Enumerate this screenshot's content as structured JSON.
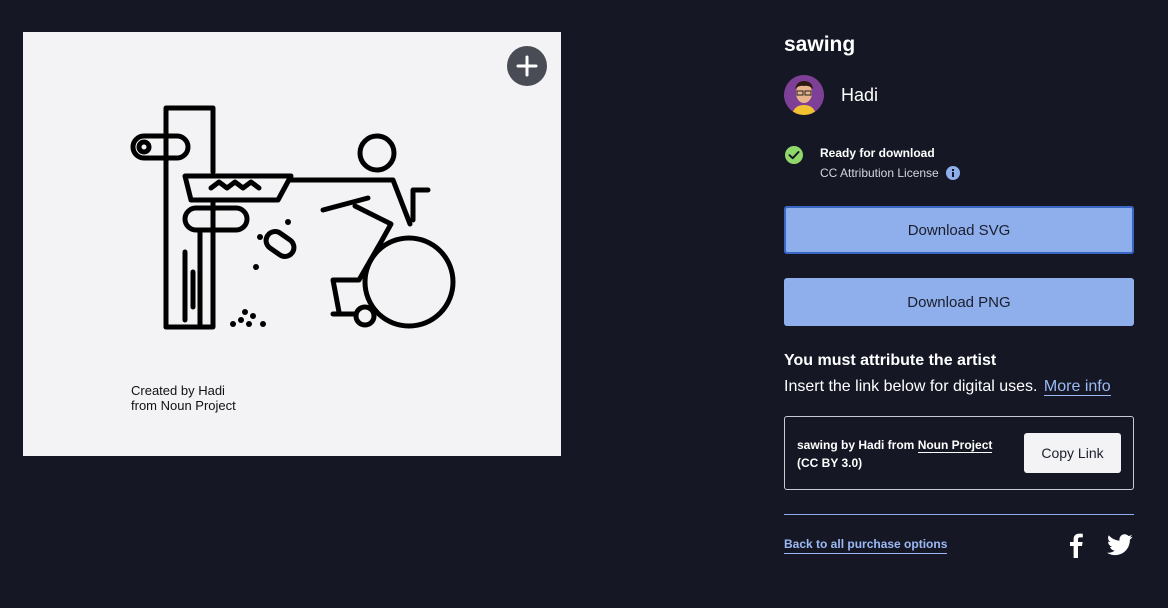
{
  "preview": {
    "credit_line1": "Created by Hadi",
    "credit_line2": "from Noun Project",
    "add_icon": "plus-icon",
    "art_icon": "sawing-wheelchair-icon"
  },
  "header": {
    "title": "sawing"
  },
  "author": {
    "name": "Hadi",
    "avatar_icon": "avatar"
  },
  "status": {
    "title": "Ready for download",
    "license": "CC Attribution License",
    "check_icon": "check-circle-icon",
    "info_icon": "info-icon"
  },
  "actions": {
    "download_svg": "Download SVG",
    "download_png": "Download PNG"
  },
  "attribution": {
    "heading": "You must attribute the artist",
    "sub": "Insert the link below for digital uses.",
    "more_info": "More info",
    "text_prefix": "sawing by Hadi from ",
    "noun_link": "Noun Project",
    "license_short": "(CC BY 3.0)",
    "copy_label": "Copy Link"
  },
  "footer": {
    "back_link": "Back to all purchase options",
    "facebook_icon": "facebook-icon",
    "twitter_icon": "twitter-icon"
  },
  "colors": {
    "background": "#151824",
    "button_blue": "#8eaeec",
    "link_blue": "#9cb9f5",
    "success_green": "#8fd86a"
  }
}
